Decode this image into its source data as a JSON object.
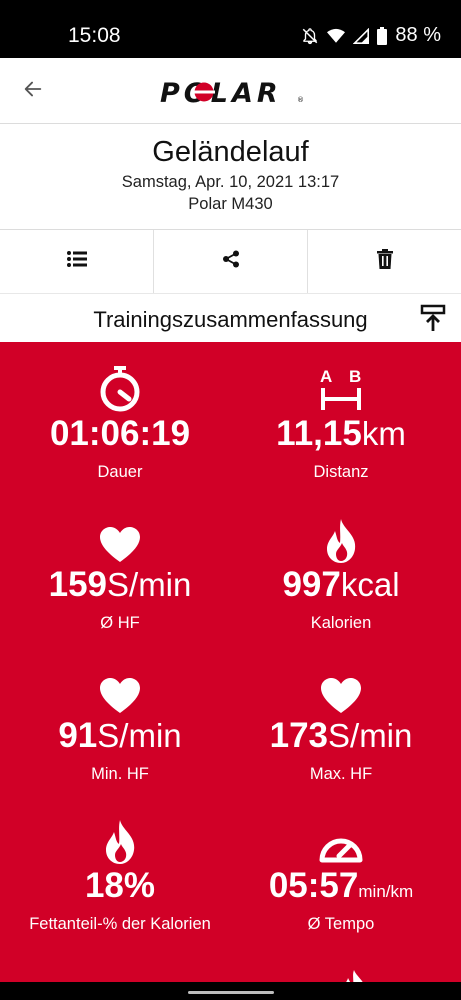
{
  "status_bar": {
    "time": "15:08",
    "battery": "88 %"
  },
  "header": {
    "logo": "POLAR"
  },
  "training": {
    "title": "Geländelauf",
    "datetime": "Samstag, Apr. 10, 2021 13:17",
    "device": "Polar M430"
  },
  "section": {
    "title": "Trainingszusammenfassung"
  },
  "stats": [
    {
      "icon": "stopwatch-icon",
      "value": "01:06:19",
      "unit": "",
      "label": "Dauer"
    },
    {
      "icon": "distance-ab-icon",
      "value": "11,15",
      "unit": "km",
      "label": "Distanz"
    },
    {
      "icon": "heart-icon",
      "value": "159",
      "unit": "S/min",
      "label": "Ø HF"
    },
    {
      "icon": "flame-icon",
      "value": "997",
      "unit": "kcal",
      "label": "Kalorien"
    },
    {
      "icon": "heart-icon",
      "value": "91",
      "unit": "S/min",
      "label": "Min. HF"
    },
    {
      "icon": "heart-icon",
      "value": "173",
      "unit": "S/min",
      "label": "Max. HF"
    },
    {
      "icon": "flame-icon",
      "value": "18%",
      "unit": "",
      "label": "Fettanteil-% der Kalorien"
    },
    {
      "icon": "speedometer-icon",
      "value": "05:57",
      "unit": "min/km",
      "label": "Ø Tempo"
    }
  ],
  "colors": {
    "accent": "#d10027",
    "status_bar": "#000000"
  }
}
